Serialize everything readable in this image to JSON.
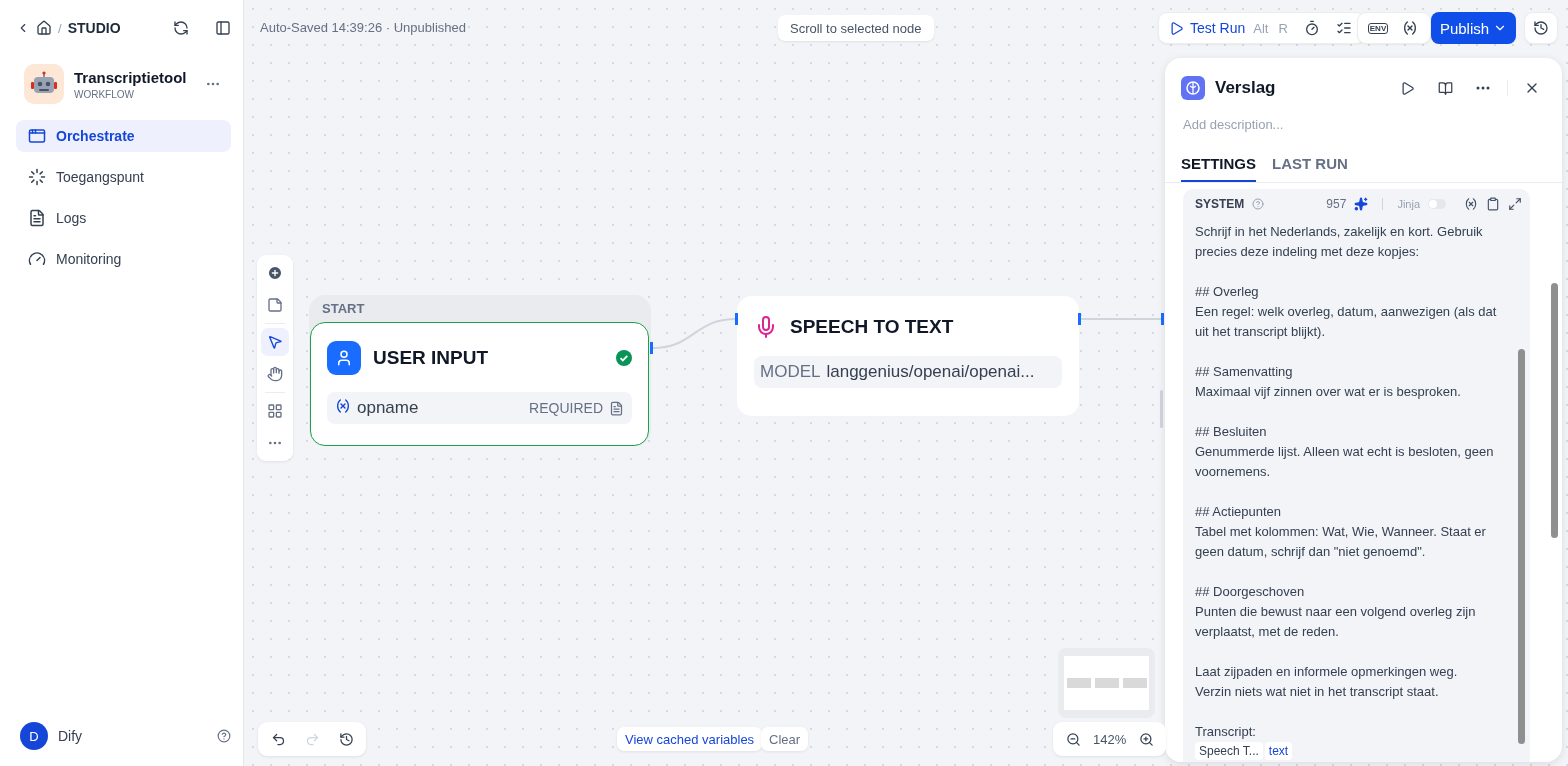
{
  "breadcrumb": {
    "separator": "/",
    "label": "STUDIO"
  },
  "env_label": "ENV",
  "app": {
    "name": "Transcriptietool",
    "type": "WORKFLOW"
  },
  "nav": [
    {
      "label": "Orchestrate",
      "kind": "orchestrate",
      "selected": true
    },
    {
      "label": "Toegangspunt",
      "kind": "access",
      "selected": false
    },
    {
      "label": "Logs",
      "kind": "logs",
      "selected": false
    },
    {
      "label": "Monitoring",
      "kind": "monitoring",
      "selected": false
    }
  ],
  "user": {
    "initial": "D",
    "name": "Dify"
  },
  "status": "Auto-Saved 14:39:26 · Unpublished",
  "scroll_button": "Scroll to selected node",
  "test_run": {
    "label": "Test Run",
    "keys": [
      "Alt",
      "R"
    ]
  },
  "publish": "Publish",
  "tools": [
    {
      "kind": "add",
      "selected": false
    },
    {
      "kind": "note",
      "selected": false
    },
    {
      "kind": "pointer",
      "selected": true
    },
    {
      "kind": "hand",
      "selected": false
    },
    {
      "kind": "organize",
      "selected": false
    },
    {
      "kind": "more",
      "selected": false
    }
  ],
  "start_node": {
    "group": "START",
    "title": "USER INPUT",
    "valid": true,
    "variable": "opname",
    "badge": "REQUIRED"
  },
  "speech_node": {
    "title": "SPEECH TO TEXT",
    "model_label": "MODEL",
    "model": "langgenius/openai/openai..."
  },
  "panel": {
    "title": "Verslag",
    "description_placeholder": "Add description...",
    "tabs": [
      {
        "label": "SETTINGS",
        "selected": true
      },
      {
        "label": "LAST RUN",
        "selected": false
      }
    ],
    "prompt": {
      "role": "SYSTEM",
      "count": "957",
      "jinja_label": "Jinja",
      "jinja_on": false,
      "paragraphs": [
        [
          "Schrijf in het Nederlands, zakelijk en kort. Gebruik precies deze indeling met deze kopjes:"
        ],
        [
          "## Overleg",
          "Een regel: welk overleg, datum, aanwezigen (als dat uit het transcript blijkt)."
        ],
        [
          "## Samenvatting",
          "Maximaal vijf zinnen over wat er is besproken."
        ],
        [
          "## Besluiten",
          "Genummerde lijst. Alleen wat echt is besloten, geen voornemens."
        ],
        [
          "## Actiepunten",
          "Tabel met kolommen: Wat, Wie, Wanneer. Staat er geen datum, schrijf dan \"niet genoemd\"."
        ],
        [
          "## Doorgeschoven",
          "Punten die bewust naar een volgend overleg zijn verplaatst, met de reden."
        ],
        [
          "Laat zijpaden en informele opmerkingen weg.",
          "Verzin niets wat niet in het transcript staat."
        ],
        [
          "Transcript:"
        ]
      ],
      "variable": {
        "node": "Speech T...",
        "name": "text"
      }
    }
  },
  "bottom": {
    "cached": "View cached variables",
    "clear": "Clear",
    "zoom": "142%"
  }
}
